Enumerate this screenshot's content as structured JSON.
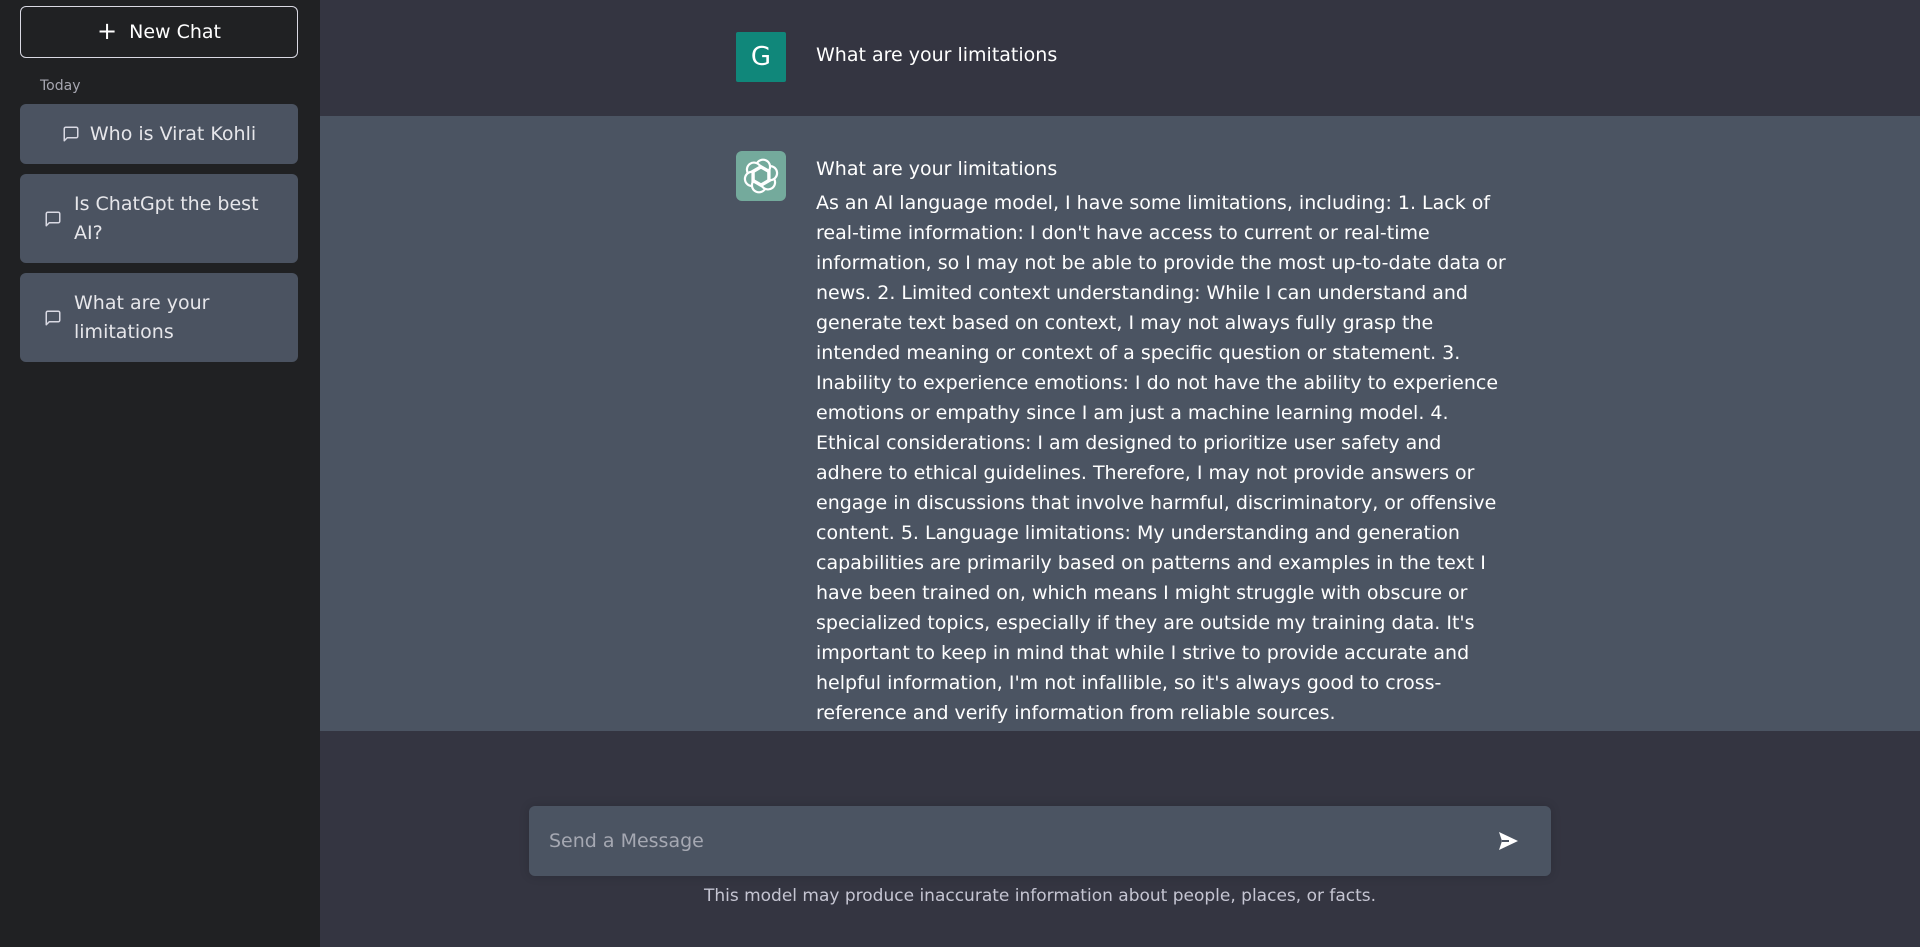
{
  "sidebar": {
    "new_chat_label": "New Chat",
    "section_label": "Today",
    "conversations": [
      {
        "label": "Who is Virat Kohli"
      },
      {
        "label": "Is ChatGpt the best AI?"
      },
      {
        "label": "What are your limitations"
      }
    ]
  },
  "messages": {
    "user": {
      "avatar_letter": "G",
      "text": "What are your limitations"
    },
    "assistant": {
      "question": "What are your limitations",
      "answer": "As an AI language model, I have some limitations, including: 1. Lack of real-time information: I don't have access to current or real-time information, so I may not be able to provide the most up-to-date data or news. 2. Limited context understanding: While I can understand and generate text based on context, I may not always fully grasp the intended meaning or context of a specific question or statement. 3. Inability to experience emotions: I do not have the ability to experience emotions or empathy since I am just a machine learning model. 4. Ethical considerations: I am designed to prioritize user safety and adhere to ethical guidelines. Therefore, I may not provide answers or engage in discussions that involve harmful, discriminatory, or offensive content. 5. Language limitations: My understanding and generation capabilities are primarily based on patterns and examples in the text I have been trained on, which means I might struggle with obscure or specialized topics, especially if they are outside my training data. It's important to keep in mind that while I strive to provide accurate and helpful information, I'm not infallible, so it's always good to cross-reference and verify information from reliable sources."
    }
  },
  "composer": {
    "placeholder": "Send a Message",
    "value": ""
  },
  "disclaimer": "This model may produce inaccurate information about people, places, or facts.",
  "icons": {
    "new_chat": "plus-icon",
    "conversation": "chat-bubble-icon",
    "assistant_avatar": "openai-logo-icon",
    "send": "send-icon"
  },
  "colors": {
    "sidebar_bg": "#202123",
    "main_bg": "#343541",
    "assistant_row_bg": "#4b5462",
    "user_avatar_bg": "#10877a",
    "assistant_avatar_bg": "#74aa9c"
  }
}
